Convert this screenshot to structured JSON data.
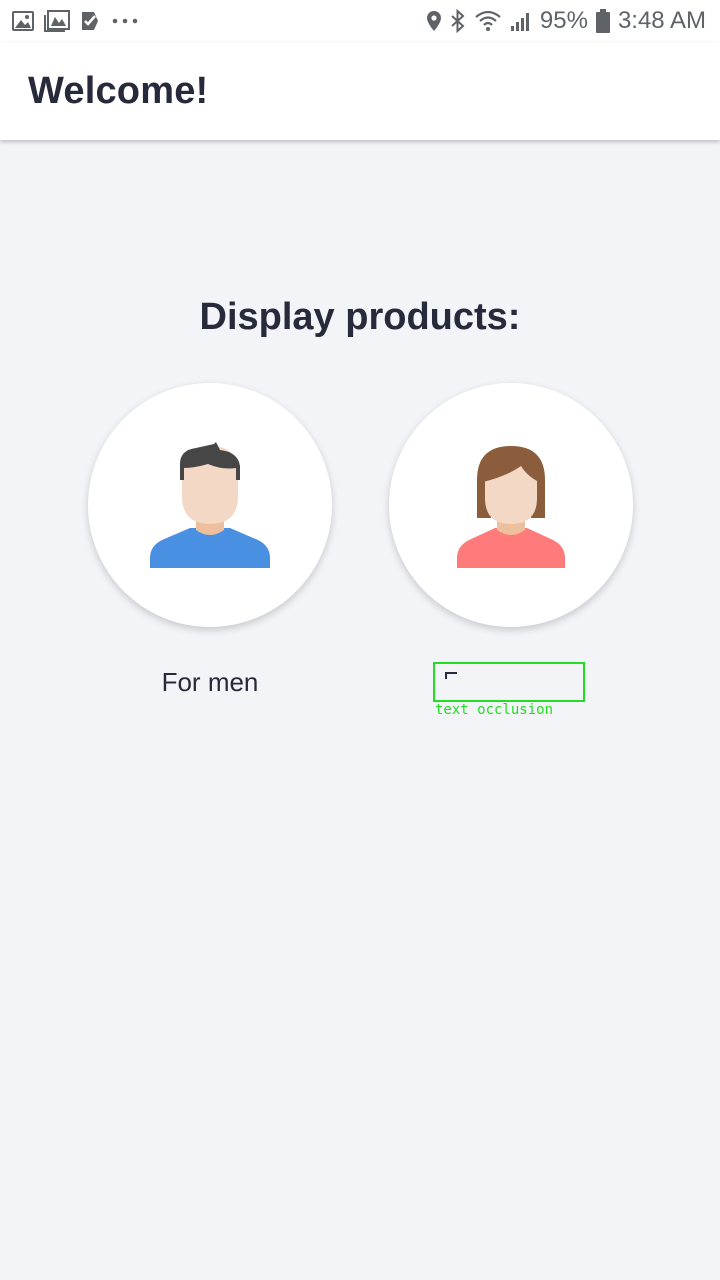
{
  "status_bar": {
    "left_icons": [
      "gallery-icon",
      "photo-icon",
      "check-icon",
      "more-dots-icon"
    ],
    "battery": "95%",
    "time": "3:48 AM",
    "right_icons": [
      "location-icon",
      "bluetooth-icon",
      "wifi-icon",
      "signal-icon",
      "battery-icon"
    ]
  },
  "app_bar": {
    "title": "Welcome!"
  },
  "main": {
    "heading": "Display products:",
    "options": [
      {
        "label": "For men",
        "icon": "man-avatar-icon",
        "shirt_color": "#4a90e2"
      },
      {
        "label": "",
        "icon": "woman-avatar-icon",
        "shirt_color": "#ff7b7b"
      }
    ]
  },
  "annotation": {
    "caption": "text occlusion",
    "color": "#22dd22"
  }
}
